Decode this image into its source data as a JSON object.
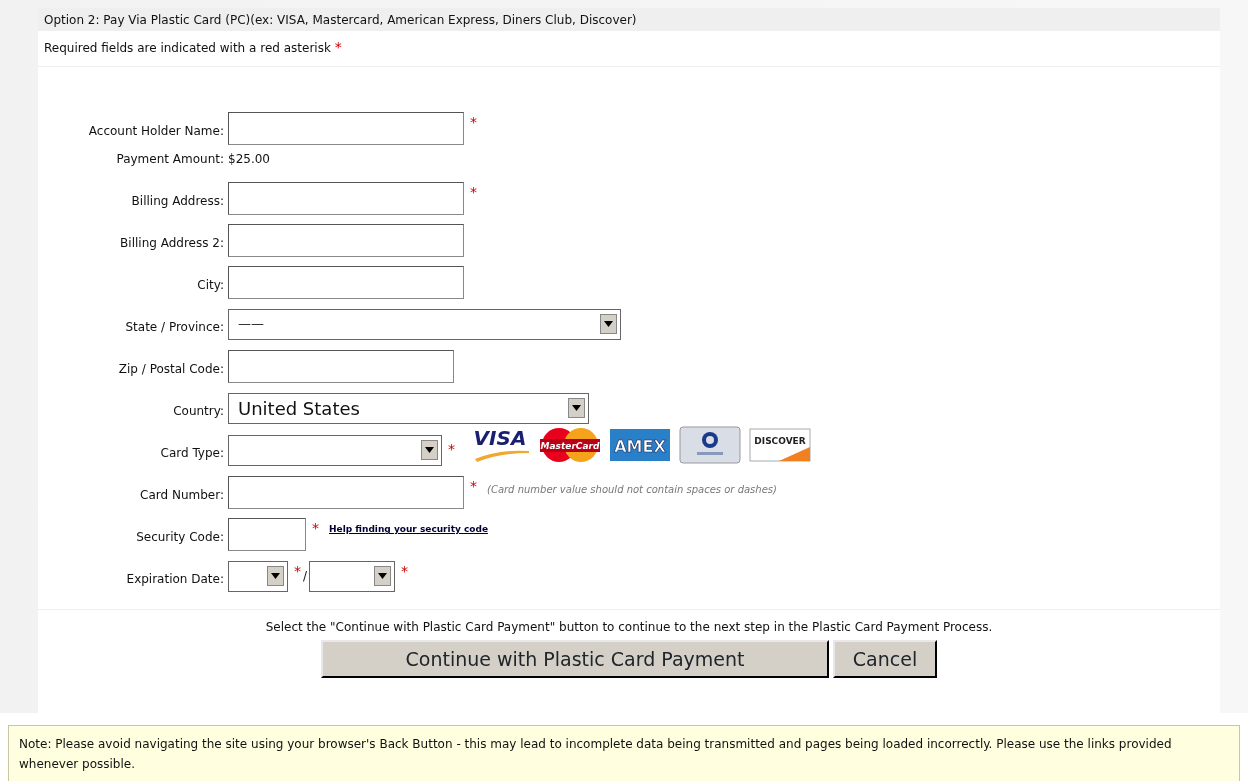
{
  "section_title": "Option 2: Pay Via Plastic Card (PC)(ex: VISA, Mastercard, American Express, Diners Club, Discover)",
  "required_note": {
    "text": "Required fields are indicated with a red asterisk",
    "marker": "*"
  },
  "fields": [
    {
      "label": "Account Holder Name:",
      "kind": "text",
      "required": true
    },
    {
      "label": "Payment Amount:",
      "kind": "static",
      "value": "$25.00",
      "required": false
    },
    {
      "label": "Billing Address:",
      "kind": "text",
      "required": true
    },
    {
      "label": "Billing Address 2:",
      "kind": "text",
      "required": false
    },
    {
      "label": "City:",
      "kind": "text",
      "required": false
    },
    {
      "label": "State / Province:",
      "kind": "select",
      "value": "——",
      "required": false
    },
    {
      "label": "Zip / Postal Code:",
      "kind": "text",
      "required": false
    },
    {
      "label": "Country:",
      "kind": "select",
      "value": "United States",
      "required": false
    },
    {
      "label": "Card Type:",
      "kind": "select",
      "required": true,
      "logos": [
        {
          "kind": "visa",
          "text": "VISA"
        },
        {
          "kind": "mastercard",
          "text": "MasterCard"
        },
        {
          "kind": "amex",
          "text": "AMEX"
        },
        {
          "kind": "diners"
        },
        {
          "kind": "discover",
          "text": "DISCOVER"
        }
      ]
    },
    {
      "label": "Card Number:",
      "kind": "text",
      "required": true,
      "hint": "(Card number value should not contain spaces or dashes)"
    },
    {
      "label": "Security Code:",
      "kind": "text",
      "required": true,
      "link": "Help finding your security code"
    },
    {
      "label": "Expiration Date:",
      "kind": "date",
      "required": true,
      "separator": "/"
    }
  ],
  "instruction": "Select the \"Continue with Plastic Card Payment\" button to continue to the next step in the Plastic Card Payment Process.",
  "buttons": [
    "Continue with Plastic Card Payment",
    "Cancel"
  ],
  "note": "Note: Please avoid navigating the site using your browser's Back Button - this may lead to incomplete data being transmitted and pages being loaded incorrectly. Please use the links provided whenever possible."
}
